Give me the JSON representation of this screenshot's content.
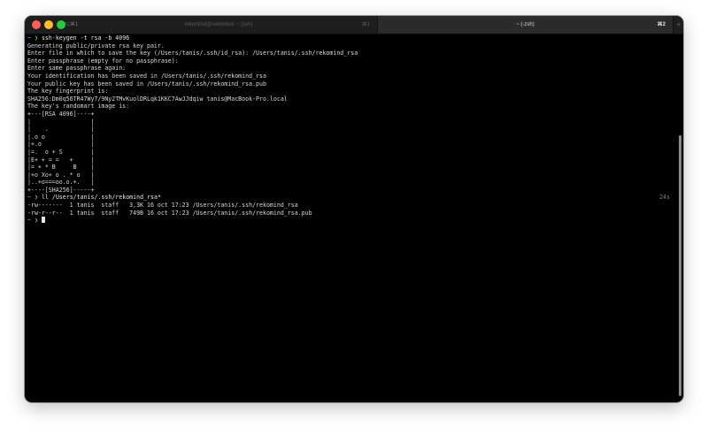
{
  "window": {
    "tabs": [
      {
        "shortcut_left": "⌥⌘1",
        "title": "rekomind@rekomind: ~ (ssh)",
        "shortcut": "⌘1",
        "active": false
      },
      {
        "title": "~ (-zsh)",
        "shortcut": "⌘2",
        "active": true
      }
    ],
    "new_tab": "+"
  },
  "terminal": {
    "prompt": "~",
    "prompt_arrow": "❯",
    "lines": [
      {
        "type": "cmd",
        "text": "ssh-keygen -t rsa -b 4096"
      },
      {
        "type": "out",
        "text": "Generating public/private rsa key pair."
      },
      {
        "type": "out",
        "text": "Enter file in which to save the key (/Users/tanis/.ssh/id_rsa): /Users/tanis/.ssh/rekomind_rsa"
      },
      {
        "type": "out",
        "text": "Enter passphrase (empty for no passphrase):"
      },
      {
        "type": "out",
        "text": "Enter same passphrase again:"
      },
      {
        "type": "out",
        "text": "Your identification has been saved in /Users/tanis/.ssh/rekomind_rsa"
      },
      {
        "type": "out",
        "text": "Your public key has been saved in /Users/tanis/.ssh/rekomind_rsa.pub"
      },
      {
        "type": "out",
        "text": "The key fingerprint is:"
      },
      {
        "type": "out",
        "text": "SHA256:Dm0q56TR47Wy7/9Ny2TMvKuolDRLqk1KKC7AwJJdqiw tanis@MacBook-Pro.local"
      },
      {
        "type": "out",
        "text": "The key's randomart image is:"
      },
      {
        "type": "out",
        "text": "+---[RSA 4096]----+"
      },
      {
        "type": "out",
        "text": "|                 |"
      },
      {
        "type": "out",
        "text": "|    .            |"
      },
      {
        "type": "out",
        "text": "|.o o             |"
      },
      {
        "type": "out",
        "text": "|+.o              |"
      },
      {
        "type": "out",
        "text": "|=.  o + S        |"
      },
      {
        "type": "out",
        "text": "|E+ + = =   +     |"
      },
      {
        "type": "out",
        "text": "|= + * B     B    |"
      },
      {
        "type": "out",
        "text": "|+o Xo+ o . * o   |"
      },
      {
        "type": "out",
        "text": "|..+o===oo.o.+.   |"
      },
      {
        "type": "out",
        "text": "+----[SHA256]-----+"
      },
      {
        "type": "cmd",
        "text": "ll /Users/tanis/.ssh/rekomind_rsa*",
        "duration": "24s"
      },
      {
        "type": "out",
        "text": "-rw-------  1 tanis  staff   3,3K 16 oct 17:23 /Users/tanis/.ssh/rekomind_rsa"
      },
      {
        "type": "out",
        "text": "-rw-r--r--  1 tanis  staff   749B 16 oct 17:23 /Users/tanis/.ssh/rekomind_rsa.pub"
      },
      {
        "type": "prompt",
        "text": ""
      }
    ]
  },
  "colors": {
    "background": "#000000",
    "text": "#d9d9d9",
    "prompt_dir": "#4fb4d8",
    "prompt_arrow": "#5fd35f"
  }
}
